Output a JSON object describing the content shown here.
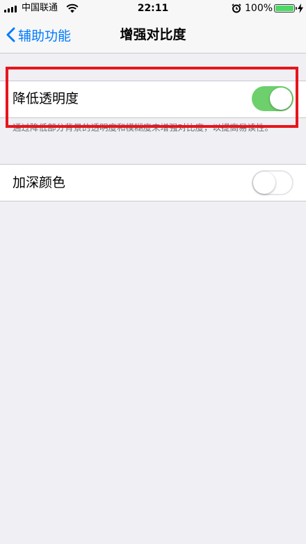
{
  "status_bar": {
    "carrier": "中国联通",
    "time": "22:11",
    "battery_percent": "100%",
    "battery_level": 1.0,
    "colors": {
      "battery": "#4cd964"
    }
  },
  "nav": {
    "back_label": "辅助功能",
    "title": "增强对比度"
  },
  "settings": {
    "reduce_transparency": {
      "label": "降低透明度",
      "enabled": true,
      "note": "通过降低部分背景的透明度和模糊度来增强对比度，以提高易读性。"
    },
    "darken_colors": {
      "label": "加深颜色",
      "enabled": false
    }
  },
  "colors": {
    "accent": "#007aff",
    "switch_on": "#6dd06d",
    "highlight_box": "#e8141c",
    "background": "#efeff4"
  },
  "icons": [
    "signal-bars-icon",
    "wifi-icon",
    "alarm-icon",
    "battery-icon",
    "charging-bolt-icon",
    "chevron-left-icon"
  ]
}
